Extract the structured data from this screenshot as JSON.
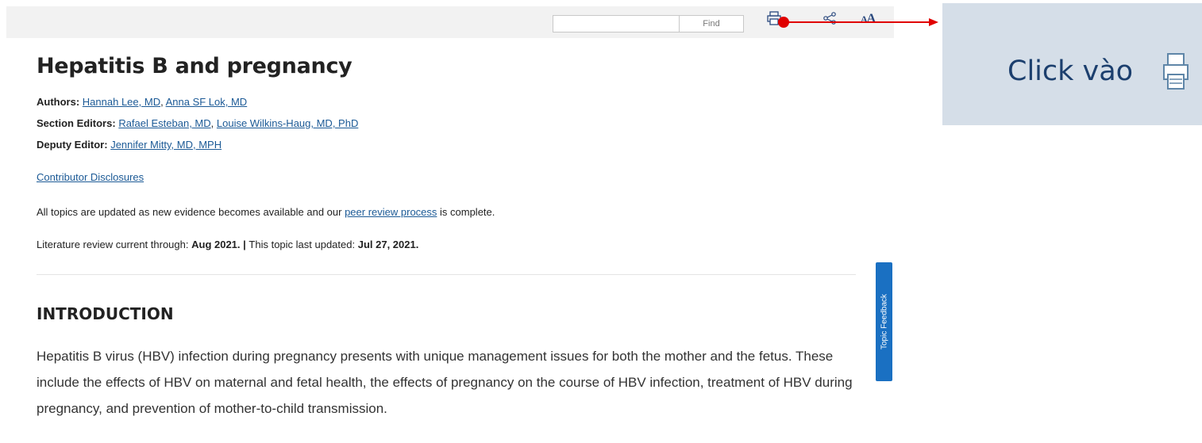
{
  "toolbar": {
    "find_placeholder": "",
    "find_button": "Find",
    "icons": [
      "print-icon",
      "share-icon",
      "font-size-icon"
    ],
    "font_icon_glyph": "A"
  },
  "annotation": {
    "arrow_color": "#e00000",
    "callout_text": "Click vào",
    "callout_icon": "print-icon",
    "callout_bg": "#d5dee8"
  },
  "article": {
    "title": "Hepatitis B and pregnancy",
    "authors_label": "Authors:",
    "authors": [
      "Hannah Lee, MD",
      "Anna SF Lok, MD"
    ],
    "section_editors_label": "Section Editors:",
    "section_editors": [
      "Rafael Esteban, MD",
      "Louise Wilkins-Haug, MD, PhD"
    ],
    "deputy_editor_label": "Deputy Editor:",
    "deputy_editor": "Jennifer Mitty, MD, MPH",
    "contributor_disclosures": "Contributor Disclosures",
    "update_text_1": "All topics are updated as new evidence becomes available and our ",
    "peer_review_link": "peer review process",
    "update_text_2": " is complete.",
    "lit_review_label": "Literature review current through: ",
    "lit_review_date": "Aug 2021.",
    "separator": " | ",
    "last_updated_label": "This topic last updated: ",
    "last_updated_date": "Jul 27, 2021.",
    "section_heading": "INTRODUCTION",
    "intro_paragraph": "Hepatitis B virus (HBV) infection during pregnancy presents with unique management issues for both the mother and the fetus. These include the effects of HBV on maternal and fetal health, the effects of pregnancy on the course of HBV infection, treatment of HBV during pregnancy, and prevention of mother-to-child transmission."
  },
  "feedback": {
    "label": "Topic Feedback",
    "color": "#1a70c2"
  },
  "colors": {
    "link": "#1c5a96",
    "toolbar_bg": "#f2f2f2",
    "icon": "#2b4a7f"
  }
}
